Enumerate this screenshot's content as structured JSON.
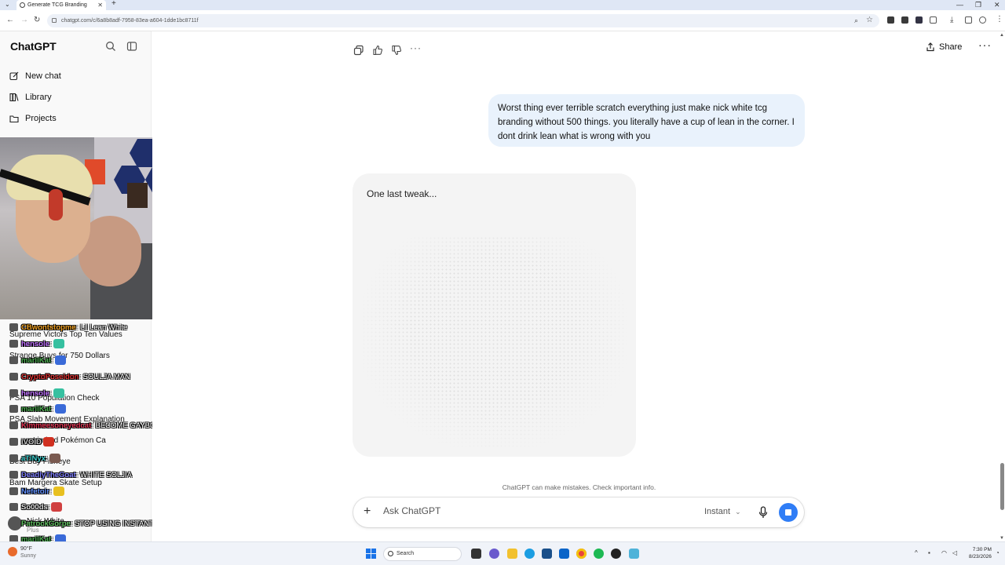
{
  "browser": {
    "tab_title": "Generate TCG Branding",
    "url": "chatgpt.com/c/6a8b8adf-7958-83ea-a604-1dde1bc8711f"
  },
  "sidebar": {
    "brand": "ChatGPT",
    "items": [
      {
        "label": "New chat",
        "icon": "compose-icon"
      },
      {
        "label": "Library",
        "icon": "library-icon"
      },
      {
        "label": "Projects",
        "icon": "folder-icon"
      }
    ],
    "chats": [
      "Supreme Victors Top Ten Values",
      "Strange Buys for 750 Dollars",
      "PSA 10 Population Check",
      "PSA Slab Movement Explanation",
      "Limited Pokémon Ca",
      "Best Buy Fisheye",
      "Bam Margera Skate Setup"
    ],
    "profile": {
      "name": "Nick White",
      "plan": "Plus"
    }
  },
  "stream_chat": [
    {
      "user": "CBwontstopme",
      "color": "#f0a020",
      "text": ": Lil Lean White"
    },
    {
      "user": "hensole",
      "color": "#c070ff",
      "text": ":",
      "emote": "#36c0a0"
    },
    {
      "user": "mariiKat",
      "color": "#4caf50",
      "text": ":",
      "emote": "#3a6ad8"
    },
    {
      "user": "CryptoPoseidon",
      "color": "#e03030",
      "text": ": SOULJA MAN"
    },
    {
      "user": "hensole",
      "color": "#c070ff",
      "text": ":",
      "emote": "#36c0a0"
    },
    {
      "user": "mariiKat",
      "color": "#4caf50",
      "text": ":",
      "emote": "#3a6ad8"
    },
    {
      "user": "Kimmeesoneyedcat",
      "color": "#e03050",
      "text": ": BECOME GAYBOY"
    },
    {
      "user": "iVOID",
      "color": "#cccccc",
      "text": "",
      "emote": "#d03020"
    },
    {
      "user": "aTiNyx",
      "color": "#40d0d0",
      "text": ":",
      "emote": "#7a5a50"
    },
    {
      "user": "DeadlyTheGoat",
      "color": "#8080ff",
      "text": ": WHITE SOLJIA"
    },
    {
      "user": "Nefetoir",
      "color": "#6090ff",
      "text": ":",
      "emote": "#e8c020"
    },
    {
      "user": "So00ds",
      "color": "#dddddd",
      "text": ":",
      "emote": "#d04040"
    },
    {
      "user": "PatrockGorpe",
      "color": "#60c060",
      "text": ": STOP USING INSTANT MODE"
    },
    {
      "user": "mariiKat",
      "color": "#4caf50",
      "text": ":",
      "emote": "#3a6ad8"
    }
  ],
  "header": {
    "share_label": "Share"
  },
  "conversation": {
    "user_message": "Worst thing ever terrible scratch everything just make nick white tcg branding without 500 things. you literally have a cup of lean in the corner. I dont drink lean what is wrong with you",
    "image_status": "One last tweak..."
  },
  "disclaimer": "ChatGPT can make mistakes. Check important info.",
  "composer": {
    "placeholder": "Ask ChatGPT",
    "model": "Instant"
  },
  "taskbar": {
    "weather_temp": "90°F",
    "weather_desc": "Sunny",
    "search_label": "Search",
    "time": "7:30 PM",
    "date": "8/23/2026"
  }
}
